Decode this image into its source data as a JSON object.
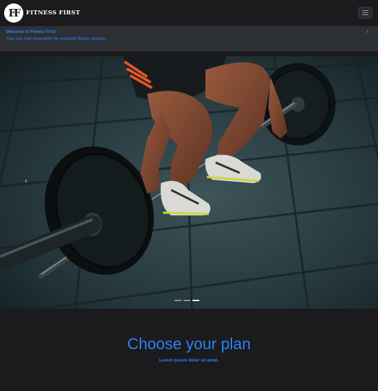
{
  "navbar": {
    "brand_name": "FITNESS FIRST",
    "logo_monogram": "FF",
    "toggler_icon": "hamburger-icon"
  },
  "alert": {
    "title": "Welcome to Fitness First!",
    "subtitle": "Your one stop destination for exclusive fitness services.",
    "close_label": "X"
  },
  "carousel": {
    "prev_label": "‹",
    "slide_count": 3,
    "active_slide": 3
  },
  "plans": {
    "title": "Choose your plan",
    "subtitle": "Lorem ipsum dolor sit amet."
  },
  "colors": {
    "accent": "#2b83f6",
    "background": "#1b1a1d",
    "alert_bg": "#2c3035"
  }
}
